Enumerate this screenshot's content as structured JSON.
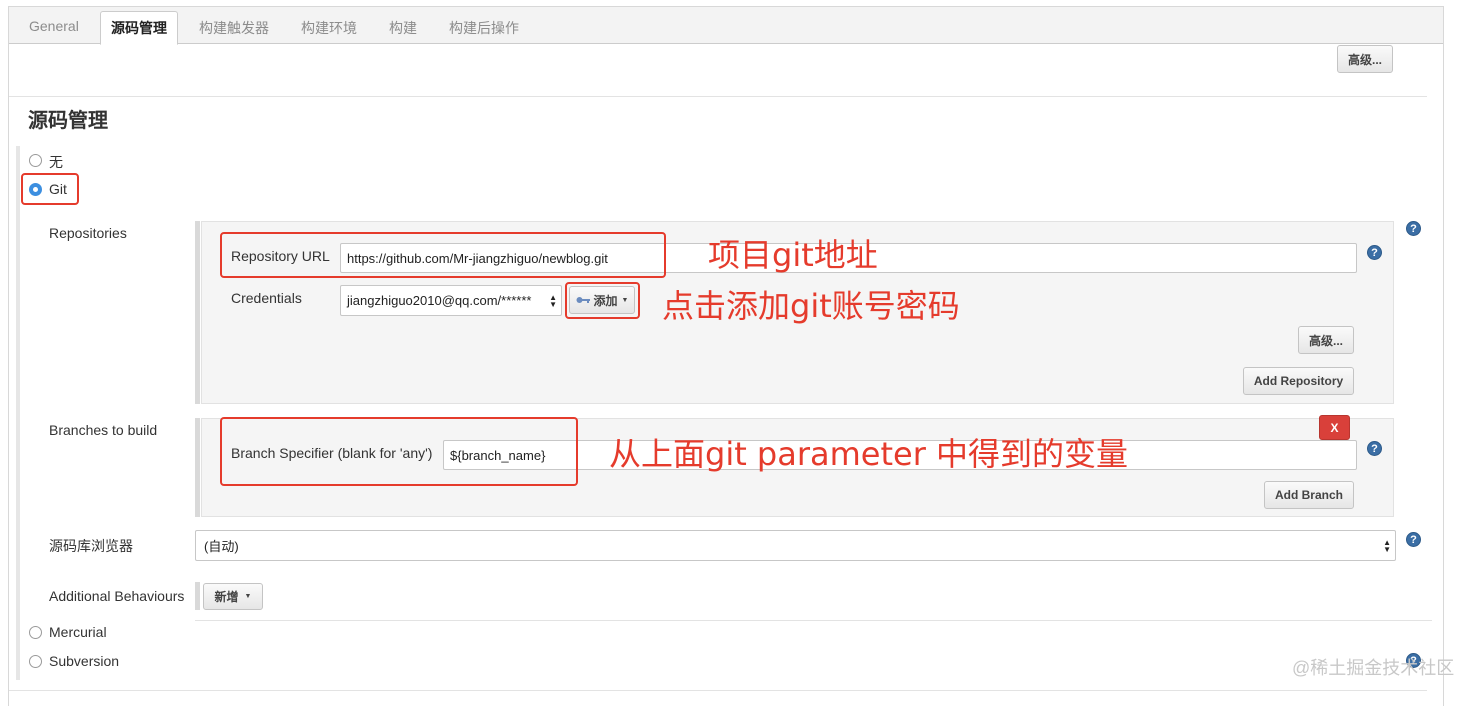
{
  "tabs": [
    {
      "label": "General",
      "active": false
    },
    {
      "label": "源码管理",
      "active": true
    },
    {
      "label": "构建触发器",
      "active": false
    },
    {
      "label": "构建环境",
      "active": false
    },
    {
      "label": "构建",
      "active": false
    },
    {
      "label": "构建后操作",
      "active": false
    }
  ],
  "top_advanced_label": "高级...",
  "section_title": "源码管理",
  "scm_options": {
    "none": "无",
    "git": "Git",
    "mercurial": "Mercurial",
    "subversion": "Subversion",
    "selected": "Git"
  },
  "repositories": {
    "label": "Repositories",
    "url_label": "Repository URL",
    "url_value": "https://github.com/Mr-jiangzhiguo/newblog.git",
    "credentials_label": "Credentials",
    "credentials_value": "jiangzhiguo2010@qq.com/******",
    "add_button": "添加",
    "advanced_button": "高级...",
    "add_repository_button": "Add Repository"
  },
  "branches": {
    "label": "Branches to build",
    "delete_button": "X",
    "specifier_label": "Branch Specifier (blank for 'any')",
    "specifier_value": "${branch_name}",
    "add_branch_button": "Add Branch"
  },
  "browser": {
    "label": "源码库浏览器",
    "value": "(自动)"
  },
  "behaviours": {
    "label": "Additional Behaviours",
    "add_button": "新增"
  },
  "help_glyph": "?",
  "annotations": {
    "repo_url": "项目git地址",
    "credentials": "点击添加git账号密码",
    "branch": "从上面git parameter 中得到的变量"
  },
  "watermark": "@稀土掘金技术社区",
  "colors": {
    "annotation_red": "#e53b2c",
    "radio_selected": "#3d8fe0",
    "help_icon": "#3b6ea5",
    "delete_button": "#d9403a"
  }
}
